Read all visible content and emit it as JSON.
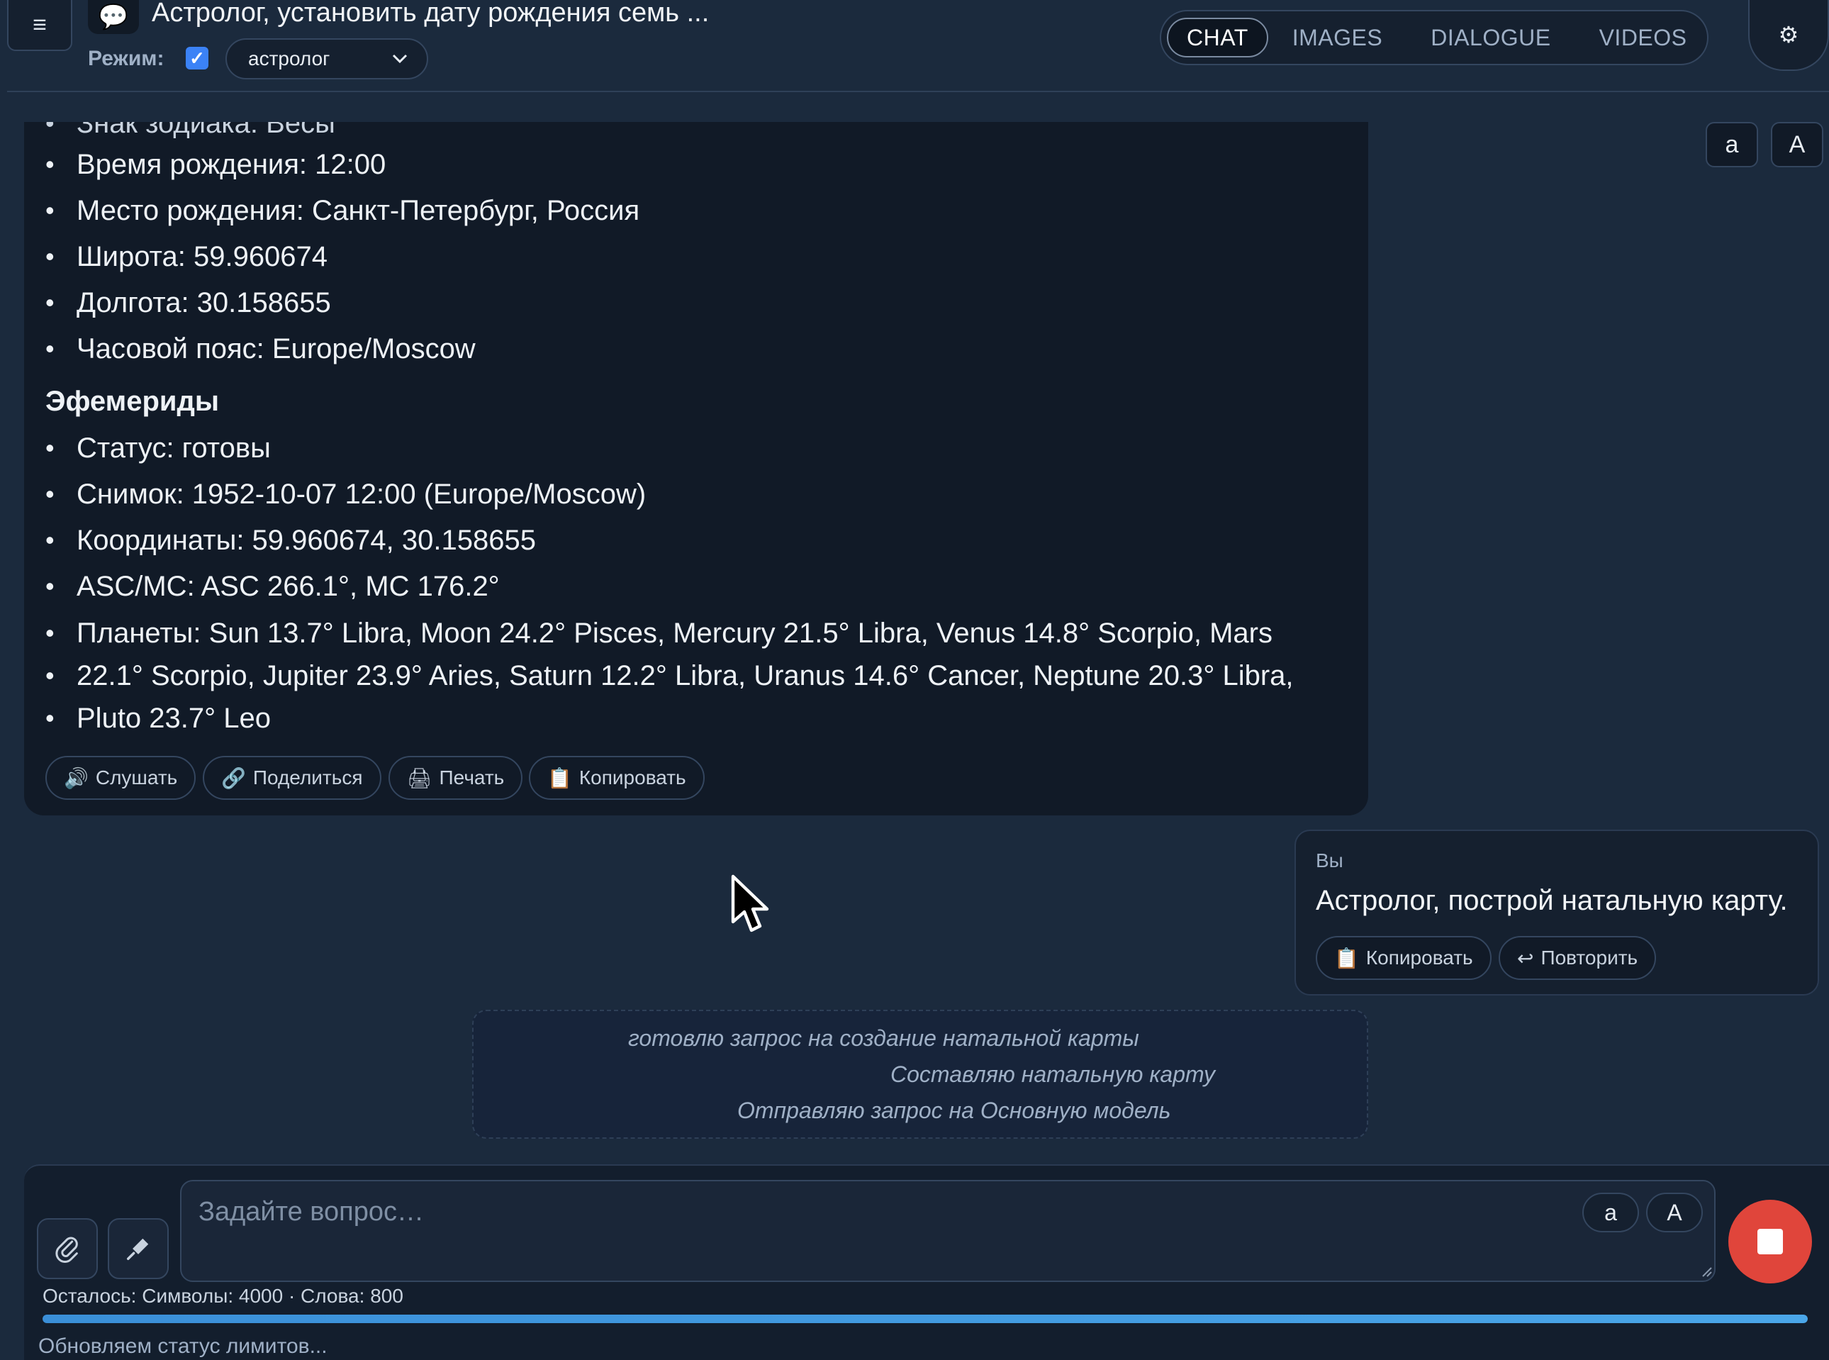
{
  "header": {
    "menu_icon": "hamburger-menu-icon",
    "chat_icon": "speech-bubble-icon",
    "title": "Астролог, установить дату рождения семь ...",
    "mode_label": "Режим:",
    "mode_checked": true,
    "mode_select_value": "астролог",
    "tabs": [
      {
        "label": "CHAT",
        "active": true
      },
      {
        "label": "IMAGES",
        "active": false
      },
      {
        "label": "DIALOGUE",
        "active": false
      },
      {
        "label": "VIDEOS",
        "active": false
      }
    ],
    "settings_icon": "gear-icon"
  },
  "font_controls": {
    "small": "a",
    "big": "A"
  },
  "assistant_message": {
    "cut_off_line": "Знак зодиака: Весы",
    "birth_items": [
      "Время рождения: 12:00",
      "Место рождения: Санкт-Петербург, Россия",
      "Широта: 59.960674",
      "Долгота: 30.158655",
      "Часовой пояс: Europe/Moscow"
    ],
    "ephemeris_heading": "Эфемериды",
    "ephemeris_items": [
      "Статус: готовы",
      "Снимок: 1952-10-07 12:00 (Europe/Moscow)",
      "Координаты: 59.960674, 30.158655",
      "ASC/MC: ASC 266.1°, MC 176.2°"
    ],
    "planets_lines": [
      "Планеты: Sun 13.7° Libra, Moon 24.2° Pisces, Mercury 21.5° Libra, Venus 14.8° Scorpio, Mars",
      "22.1° Scorpio, Jupiter 23.9° Aries, Saturn 12.2° Libra, Uranus 14.6° Cancer, Neptune 20.3° Libra,",
      "Pluto 23.7° Leo"
    ],
    "actions": {
      "listen": {
        "icon": "🔊",
        "label": "Слушать"
      },
      "share": {
        "icon": "🔗",
        "label": "Поделиться"
      },
      "print": {
        "icon": "🖨",
        "label": "Печать"
      },
      "copy": {
        "icon": "📋",
        "label": "Копировать"
      }
    }
  },
  "user_message": {
    "author": "Вы",
    "text": "Астролог, построй натальную карту.",
    "actions": {
      "copy": {
        "icon": "📋",
        "label": "Копировать"
      },
      "repeat": {
        "icon": "↩",
        "label": "Повторить"
      }
    }
  },
  "status_lines": [
    "готовлю запрос на создание натальной карты",
    "Составляю натальную карту",
    "Отправляю запрос на Основную модель"
  ],
  "composer": {
    "attach_icon": "paperclip-icon",
    "mic_icon": "microphone-icon",
    "placeholder": "Задайте вопрос…",
    "font_small": "a",
    "font_big": "A",
    "stop_icon": "stop-icon",
    "limits_text": "Осталось: Символы: 4000 · Слова: 800",
    "limits_progress_percent": 100,
    "limits_status": "Обновляем статус лимитов..."
  },
  "colors": {
    "background": "#1b2a3d",
    "card": "#111a27",
    "accent": "#3b82f6",
    "stop": "#e0453b",
    "progress": "#3a8fd8"
  }
}
